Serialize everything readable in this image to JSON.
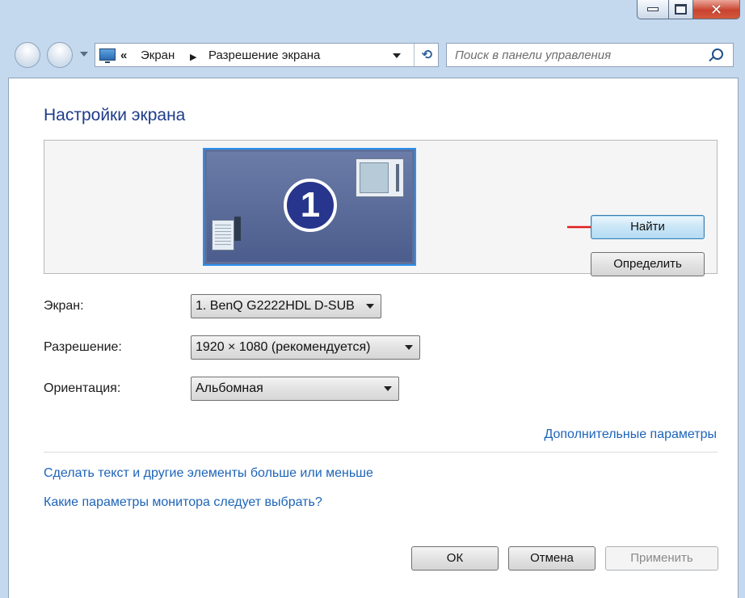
{
  "window": {
    "caption_icons": {
      "minimize": "minimize-icon",
      "maximize": "maximize-icon",
      "close": "close-icon"
    },
    "close_glyph": "✕",
    "close_color": "#c9432f"
  },
  "nav": {
    "breadcrumb_prefix": "«",
    "crumbs": [
      "Экран",
      "Разрешение экрана"
    ],
    "separator": "▶",
    "refresh_glyph": "⟲",
    "search_placeholder": "Поиск в панели управления"
  },
  "main": {
    "title": "Настройки экрана",
    "monitor_number": "1",
    "find_button": "Найти",
    "identify_button": "Определить",
    "display_label": "Экран:",
    "display_value": "1. BenQ G2222HDL D-SUB",
    "resolution_label": "Разрешение:",
    "resolution_value": "1920 × 1080 (рекомендуется)",
    "orientation_label": "Ориентация:",
    "orientation_value": "Альбомная",
    "advanced_link": "Дополнительные параметры",
    "text_size_link": "Сделать текст и другие элементы больше или меньше",
    "monitor_params_link": "Какие параметры монитора следует выбрать?"
  },
  "footer": {
    "ok": "ОК",
    "cancel": "Отмена",
    "apply": "Применить"
  },
  "colors": {
    "accent_blue": "#1e3c8a",
    "link_blue": "#1d64b8",
    "monitor_selected_border": "#2b91ee",
    "annotation_arrow": "#e21b1b"
  }
}
